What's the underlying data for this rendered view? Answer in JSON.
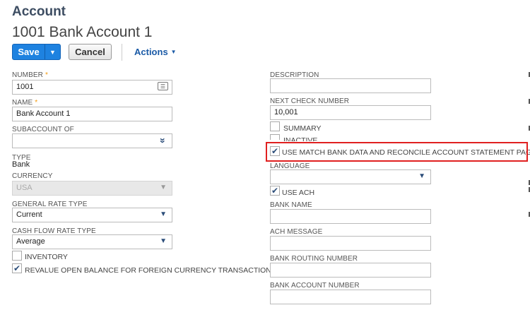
{
  "header": {
    "record_type": "Account",
    "record_name": "1001 Bank Account 1"
  },
  "toolbar": {
    "save_label": "Save",
    "cancel_label": "Cancel",
    "actions_label": "Actions"
  },
  "left": {
    "number": {
      "label": "NUMBER",
      "value": "1001"
    },
    "name": {
      "label": "NAME",
      "value": "Bank Account 1"
    },
    "subaccount_of": {
      "label": "SUBACCOUNT OF",
      "value": ""
    },
    "type": {
      "label": "TYPE",
      "value": "Bank"
    },
    "currency": {
      "label": "CURRENCY",
      "value": "USA"
    },
    "general_rate_type": {
      "label": "GENERAL RATE TYPE",
      "value": "Current"
    },
    "cash_flow_rate_type": {
      "label": "CASH FLOW RATE TYPE",
      "value": "Average"
    },
    "inventory": {
      "label": "INVENTORY",
      "checked": false
    },
    "revalue": {
      "label": "REVALUE OPEN BALANCE FOR FOREIGN CURRENCY TRANSACTIONS",
      "checked": true
    }
  },
  "right": {
    "description": {
      "label": "DESCRIPTION",
      "value": ""
    },
    "next_check_number": {
      "label": "NEXT CHECK NUMBER",
      "value": "10,001"
    },
    "summary": {
      "label": "SUMMARY",
      "checked": false
    },
    "inactive": {
      "label": "INACTIVE",
      "checked": false
    },
    "match_bank_data": {
      "label": "USE MATCH BANK DATA AND RECONCILE ACCOUNT STATEMENT PAGES",
      "checked": true
    },
    "language": {
      "label": "LANGUAGE",
      "value": ""
    },
    "use_ach": {
      "label": "USE ACH",
      "checked": true
    },
    "bank_name": {
      "label": "BANK NAME",
      "value": ""
    },
    "ach_message": {
      "label": "ACH MESSAGE",
      "value": ""
    },
    "bank_routing_number": {
      "label": "BANK ROUTING NUMBER",
      "value": ""
    },
    "bank_account_number": {
      "label": "BANK ACCOUNT NUMBER",
      "value": ""
    }
  },
  "icons": {
    "checkmark": "✔",
    "select_arrow": "▼",
    "double_chevron": "»"
  },
  "colors": {
    "primary": "#1e82e0",
    "link": "#1a5aa6",
    "required": "#f39c12",
    "highlight": "#e02020"
  }
}
